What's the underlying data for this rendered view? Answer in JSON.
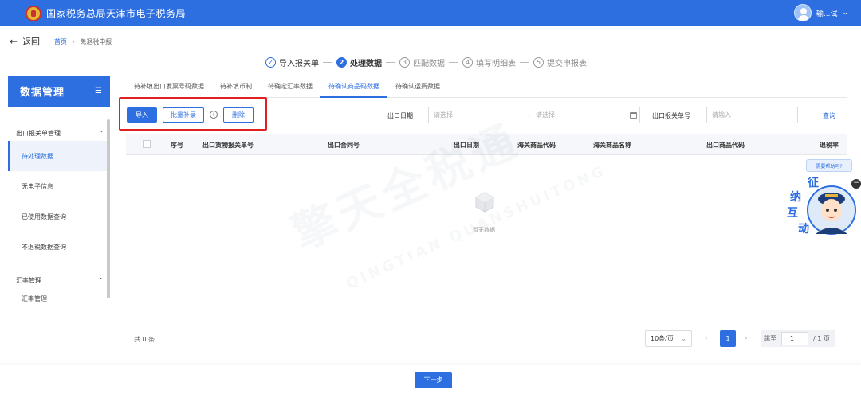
{
  "header": {
    "title": "国家税务总局天津市电子税务局",
    "username": "输...试"
  },
  "nav": {
    "back_label": "返回",
    "breadcrumb": [
      "首页",
      "免退税申报"
    ]
  },
  "steps": [
    {
      "num": "✓",
      "label": "导入报关单",
      "state": "done"
    },
    {
      "num": "2",
      "label": "处理数据",
      "state": "active"
    },
    {
      "num": "3",
      "label": "匹配数据",
      "state": "pending"
    },
    {
      "num": "4",
      "label": "填写明细表",
      "state": "pending"
    },
    {
      "num": "5",
      "label": "提交申报表",
      "state": "pending"
    }
  ],
  "sidebar": {
    "title": "数据管理",
    "groups": [
      {
        "label": "出口报关单管理",
        "items": [
          "待处理数据",
          "无电子信息",
          "已使用数据查询",
          "不退税数据查询"
        ],
        "active": "待处理数据"
      },
      {
        "label": "汇率管理",
        "items": [
          "汇率管理"
        ]
      }
    ]
  },
  "tabs": [
    "待补填出口发票号码数据",
    "待补填币制",
    "待确定汇率数据",
    "待确认商品码数据",
    "待确认运费数据"
  ],
  "active_tab": "待确认商品码数据",
  "toolbar": {
    "import_label": "导入",
    "batch_label": "批量补录",
    "delete_label": "删除"
  },
  "filters": {
    "date_label": "出口日期",
    "date_start_placeholder": "请选择",
    "date_end_placeholder": "请选择",
    "date_sep": "-",
    "customs_no_label": "出口报关单号",
    "customs_no_placeholder": "请输入",
    "query_label": "查询"
  },
  "table": {
    "columns": [
      "序号",
      "出口货物报关单号",
      "出口合同号",
      "出口日期",
      "海关商品代码",
      "海关商品名称",
      "出口商品代码",
      "退税率"
    ],
    "empty_text": "暂无数据"
  },
  "watermark": {
    "main": "擎天全税通",
    "sub": "QINGTIAN QUANSHUITONG"
  },
  "helper": {
    "bubble": "需要帮助吗?",
    "mascot_text": [
      "征",
      "纳",
      "互",
      "动"
    ],
    "close": "−"
  },
  "pagination": {
    "total_text": "共 0 条",
    "page_size": "10条/页",
    "current_page": "1",
    "jump_label": "跳至",
    "jump_value": "1",
    "total_pages": "/ 1 页"
  },
  "footer": {
    "next_label": "下一步"
  },
  "colors": {
    "primary": "#2d6fe0",
    "highlight": "#e02020"
  }
}
